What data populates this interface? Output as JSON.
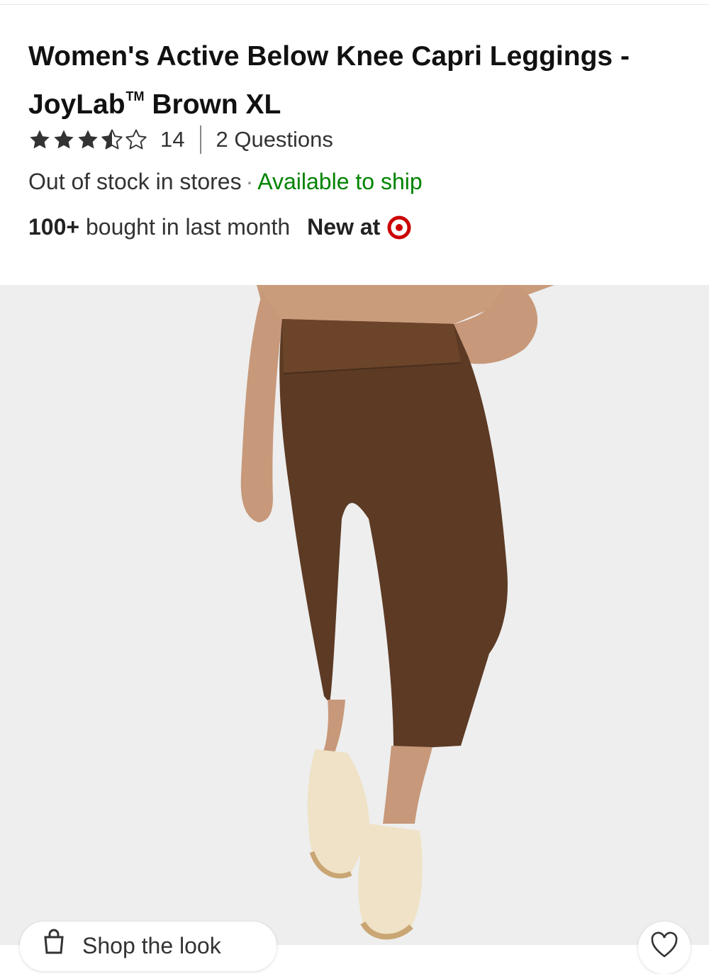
{
  "product": {
    "title": "Women's Active Below Knee Capri Leggings - JoyLab",
    "trademark": "TM",
    "title_suffix": "Brown XL"
  },
  "rating": {
    "stars": 3.5,
    "max_stars": 5,
    "review_count": "14",
    "questions": "2 Questions"
  },
  "availability": {
    "stores": "Out of stock in stores",
    "separator": "·",
    "shipping": "Available to ship"
  },
  "social_proof": {
    "count": "100+",
    "text": "bought in last month",
    "new_at": "New at"
  },
  "colors": {
    "ship_green": "#008300",
    "target_red": "#cc0000",
    "legging_brown": "#5c3a24"
  },
  "bottom_bar": {
    "shop_label": "Shop the look"
  },
  "icons": {
    "bag": "shopping-bag-icon",
    "heart": "heart-icon",
    "brand": "target-logo"
  }
}
